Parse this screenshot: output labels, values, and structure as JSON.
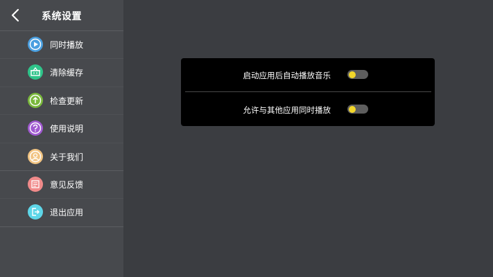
{
  "header": {
    "title": "系统设置"
  },
  "menu": [
    {
      "label": "同时播放",
      "icon": "play-icon",
      "color": "#4a9fe0"
    },
    {
      "label": "清除缓存",
      "icon": "basket-icon",
      "color": "#2fc48a"
    },
    {
      "label": "检查更新",
      "icon": "upload-arrow-icon",
      "color": "#7ab83c"
    },
    {
      "label": "使用说明",
      "icon": "question-icon",
      "color": "#a15ad1"
    },
    {
      "label": "关于我们",
      "icon": "person-icon",
      "color": "#f2c482"
    },
    {
      "label": "意见反馈",
      "icon": "feedback-icon",
      "color": "#f08a8a"
    },
    {
      "label": "退出应用",
      "icon": "exit-icon",
      "color": "#5ed6e8"
    }
  ],
  "settings": [
    {
      "label": "启动应用后自动播放音乐",
      "enabled": false
    },
    {
      "label": "允许与其他应用同时播放",
      "enabled": false
    }
  ],
  "colors": {
    "knob": "#f2d62a",
    "track": "#5e5e5e",
    "sidebar": "#47494d",
    "main": "#3b3d41"
  }
}
